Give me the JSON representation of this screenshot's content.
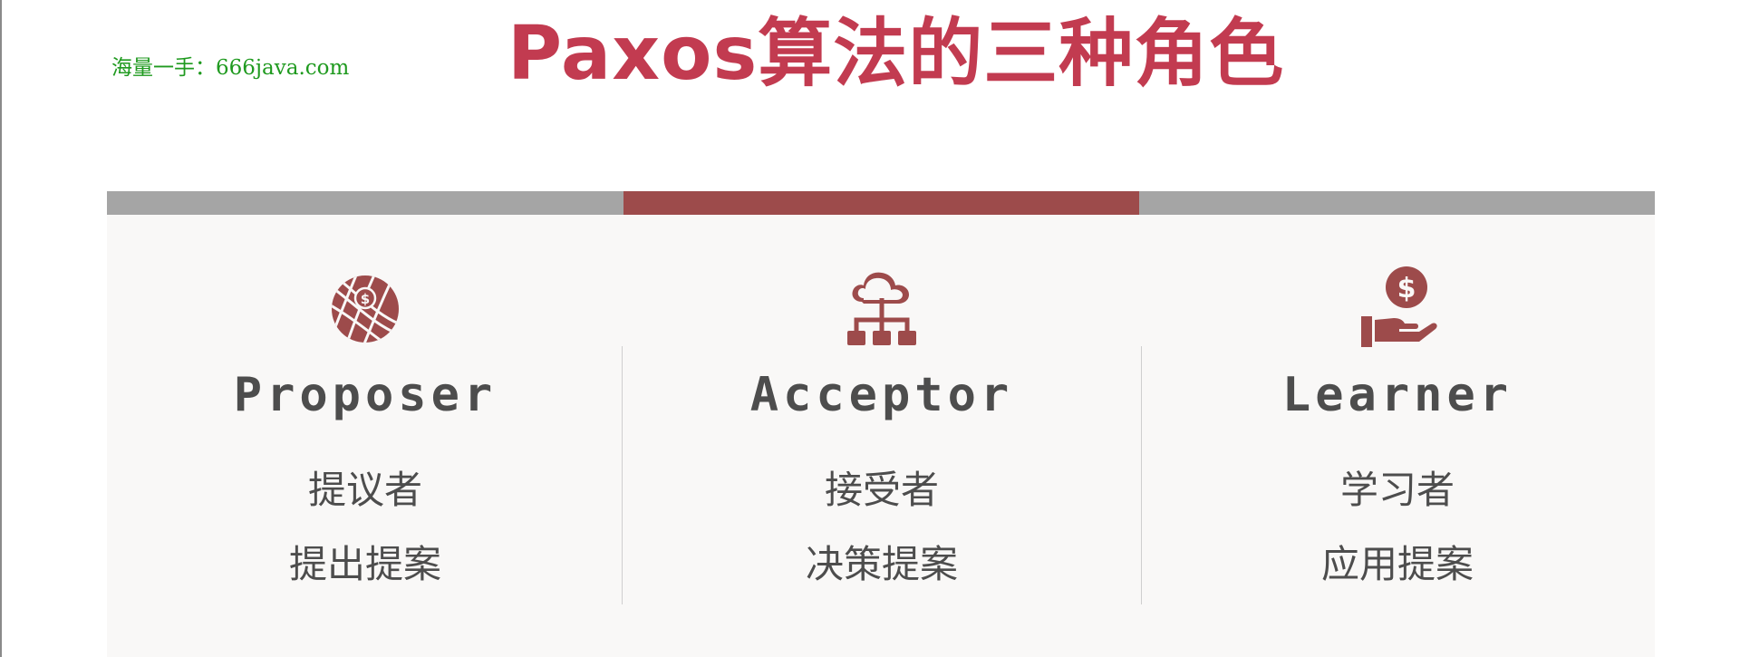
{
  "watermark": "海量一手：666java.com",
  "title": "Paxos算法的三种角色",
  "colors": {
    "title": "#c23b50",
    "accent": "#9d4b4b",
    "tab_inactive": "#a5a5a5",
    "watermark": "#1f9a1f",
    "text": "#4d4d4d"
  },
  "roles": [
    {
      "icon": "globe-dollar-icon",
      "name": "Proposer",
      "cn": "提议者",
      "desc": "提出提案",
      "active": false
    },
    {
      "icon": "cloud-network-icon",
      "name": "Acceptor",
      "cn": "接受者",
      "desc": "决策提案",
      "active": true
    },
    {
      "icon": "hand-dollar-icon",
      "name": "Learner",
      "cn": "学习者",
      "desc": "应用提案",
      "active": false
    }
  ]
}
